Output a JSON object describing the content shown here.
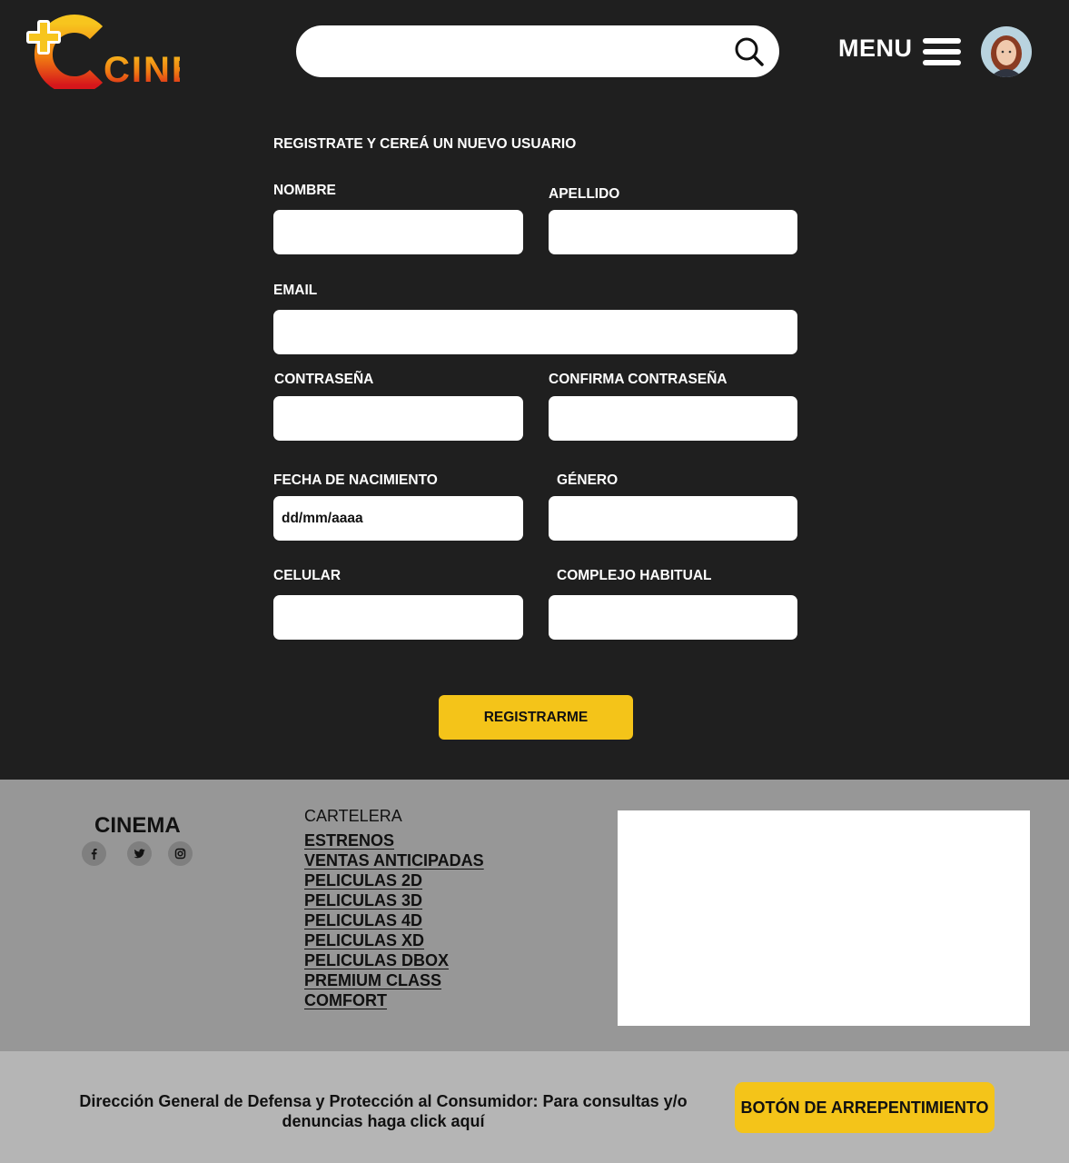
{
  "header": {
    "logo_text": "CINE",
    "search_placeholder": "",
    "menu_label": "MENU"
  },
  "form": {
    "title": "REGISTRATE Y CEREÁ UN NUEVO USUARIO",
    "fields": {
      "nombre": {
        "label": "NOMBRE",
        "placeholder": ""
      },
      "apellido": {
        "label": "APELLIDO",
        "placeholder": ""
      },
      "email": {
        "label": "EMAIL",
        "placeholder": ""
      },
      "contrasena": {
        "label": "CONTRASEÑA",
        "placeholder": ""
      },
      "confirma": {
        "label": "CONFIRMA CONTRASEÑA",
        "placeholder": ""
      },
      "fecha": {
        "label": "FECHA DE NACIMIENTO",
        "placeholder": "dd/mm/aaaa"
      },
      "genero": {
        "label": "GÉNERO",
        "placeholder": ""
      },
      "celular": {
        "label": "CELULAR",
        "placeholder": ""
      },
      "complejo": {
        "label": "COMPLEJO HABITUAL",
        "placeholder": ""
      }
    },
    "submit_label": "REGISTRARME"
  },
  "footer": {
    "brand": "CINEMA",
    "social_icons": [
      "facebook-icon",
      "twitter-icon",
      "instagram-icon"
    ],
    "cartelera_title": "CARTELERA",
    "links": [
      "ESTRENOS",
      "VENTAS ANTICIPADAS",
      "PELICULAS 2D",
      "PELICULAS 3D",
      "PELICULAS 4D",
      "PELICULAS XD",
      "PELICULAS DBOX",
      "PREMIUM CLASS",
      "COMFORT"
    ],
    "consumer_text": "Dirección General de Defensa y Protección al Consumidor: Para consultas y/o denuncias haga click aquí",
    "regret_button": "BOTÓN DE ARREPENTIMIENTO"
  },
  "colors": {
    "background": "#1f1f1f",
    "accent_yellow": "#f4c419",
    "footer_gray": "#979797",
    "bottom_gray": "#b5b5b5"
  }
}
